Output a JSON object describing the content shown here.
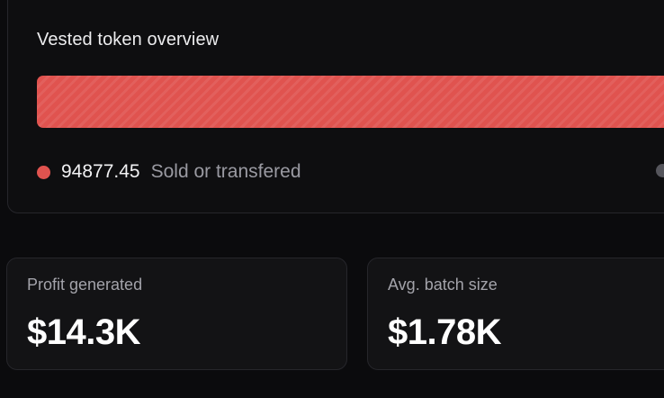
{
  "overview": {
    "title": "Vested token overview",
    "bar": {
      "segments": [
        {
          "label": "Sold or transfered",
          "value": "94877.45",
          "color": "#e0534f",
          "fraction": 1.0
        }
      ]
    },
    "legend": [
      {
        "value": "94877.45",
        "label": "Sold or transfered",
        "color": "#e0534f"
      },
      {
        "value": "",
        "label": "",
        "color": "#55555c"
      }
    ]
  },
  "stats": [
    {
      "label": "Profit generated",
      "value": "$14.3K"
    },
    {
      "label": "Avg. batch size",
      "value": "$1.78K"
    }
  ],
  "colors": {
    "background": "#0b0b0d",
    "card": "#131315",
    "accent_red": "#e0534f"
  }
}
